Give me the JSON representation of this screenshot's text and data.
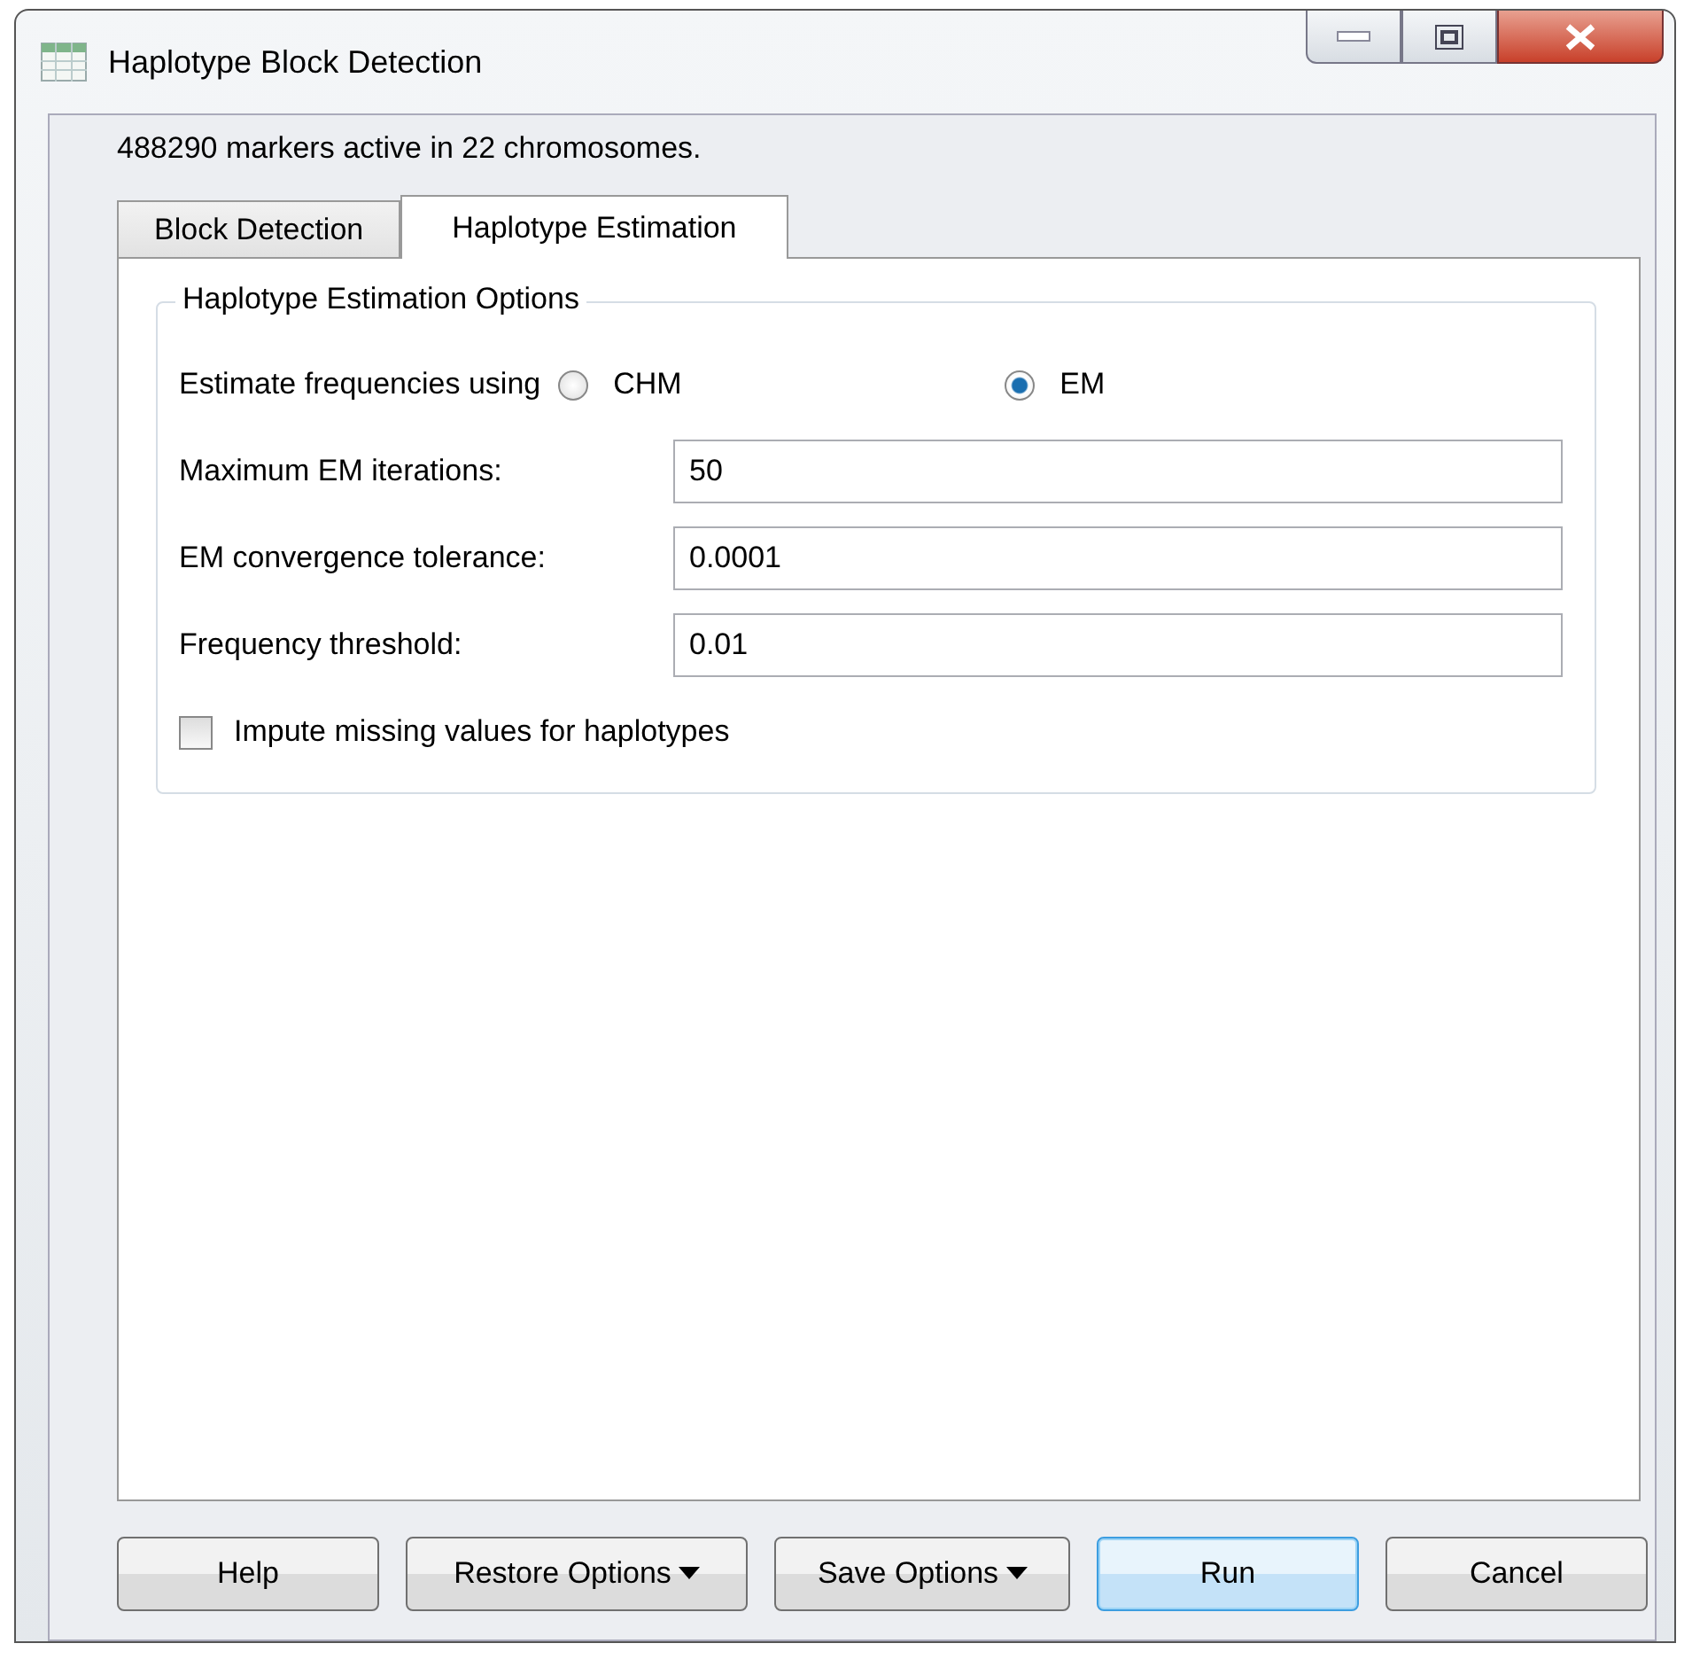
{
  "window": {
    "title": "Haplotype Block Detection"
  },
  "status": "488290 markers active in 22 chromosomes.",
  "tabs": [
    {
      "label": "Block Detection",
      "selected": false
    },
    {
      "label": "Haplotype Estimation",
      "selected": true
    }
  ],
  "group": {
    "title": "Haplotype Estimation Options",
    "method": {
      "label": "Estimate frequencies using",
      "options": [
        {
          "label": "CHM",
          "selected": false
        },
        {
          "label": "EM",
          "selected": true
        }
      ]
    },
    "fields": [
      {
        "label": "Maximum EM iterations:",
        "value": "50"
      },
      {
        "label": "EM convergence tolerance:",
        "value": "0.0001"
      },
      {
        "label": "Frequency threshold:",
        "value": "0.01"
      }
    ],
    "checkbox": {
      "label": "Impute missing values for haplotypes",
      "checked": false
    }
  },
  "buttons": [
    {
      "label": "Help",
      "menu": false,
      "default": false
    },
    {
      "label": "Restore Options",
      "menu": true,
      "default": false
    },
    {
      "label": "Save Options",
      "menu": true,
      "default": false
    },
    {
      "label": "Run",
      "menu": false,
      "default": true
    },
    {
      "label": "Cancel",
      "menu": false,
      "default": false
    }
  ]
}
